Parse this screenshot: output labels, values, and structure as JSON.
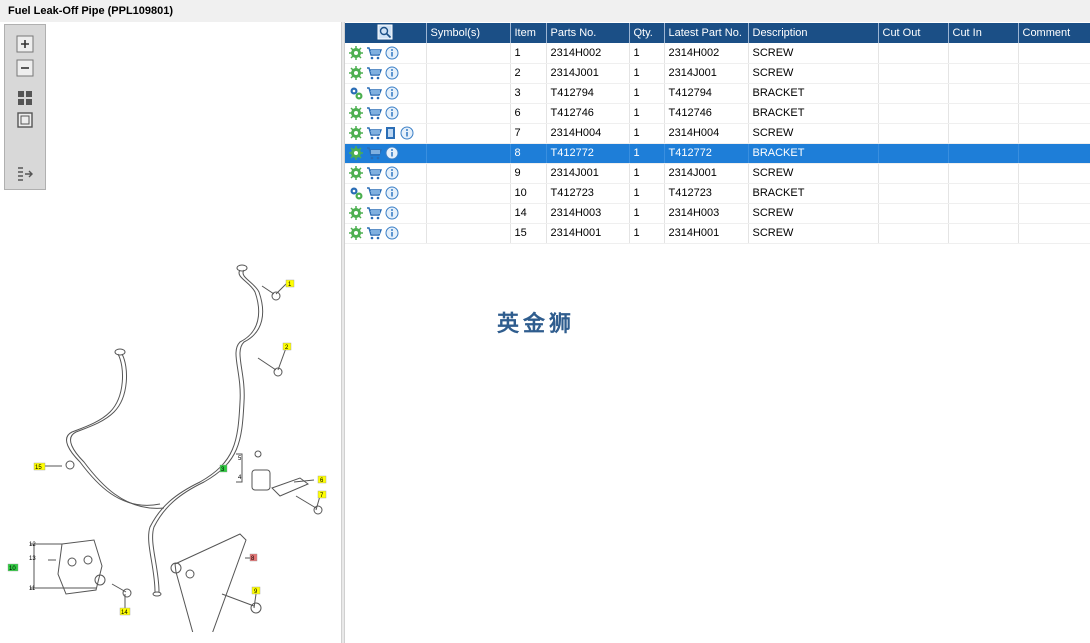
{
  "window": {
    "title": "Fuel Leak-Off Pipe (PPL109801)"
  },
  "zoom_toolbar": [
    {
      "name": "zoom-in-icon"
    },
    {
      "name": "zoom-out-icon"
    },
    {
      "name": "fit-all-icon"
    },
    {
      "name": "actual-size-icon"
    },
    {
      "name": "toggle-panel-icon"
    }
  ],
  "diagram": {
    "callouts": [
      "1",
      "2",
      "15",
      "5",
      "4",
      "6",
      "7",
      "12",
      "13",
      "11",
      "14",
      "8",
      "9"
    ],
    "box_labels": [
      "3",
      "10"
    ]
  },
  "table": {
    "columns": [
      "",
      "Symbol(s)",
      "Item",
      "Parts No.",
      "Qty.",
      "Latest Part No.",
      "Description",
      "Cut Out",
      "Cut In",
      "Comment"
    ],
    "rows": [
      {
        "item": "1",
        "parts_no": "2314H002",
        "qty": "1",
        "latest": "2314H002",
        "description": "SCREW",
        "cut_out": "",
        "cut_in": "",
        "comment": "",
        "icons": [
          "gear-icon",
          "cart-icon",
          "info-icon"
        ]
      },
      {
        "item": "2",
        "parts_no": "2314J001",
        "qty": "1",
        "latest": "2314J001",
        "description": "SCREW",
        "cut_out": "",
        "cut_in": "",
        "comment": "",
        "icons": [
          "gear-icon",
          "cart-icon",
          "info-icon"
        ]
      },
      {
        "item": "3",
        "parts_no": "T412794",
        "qty": "1",
        "latest": "T412794",
        "description": "BRACKET",
        "cut_out": "",
        "cut_in": "",
        "comment": "",
        "icons": [
          "gears-multi-icon",
          "cart-icon",
          "info-icon"
        ]
      },
      {
        "item": "6",
        "parts_no": "T412746",
        "qty": "1",
        "latest": "T412746",
        "description": "BRACKET",
        "cut_out": "",
        "cut_in": "",
        "comment": "",
        "icons": [
          "gear-icon",
          "cart-icon",
          "info-icon"
        ]
      },
      {
        "item": "7",
        "parts_no": "2314H004",
        "qty": "1",
        "latest": "2314H004",
        "description": "SCREW",
        "cut_out": "",
        "cut_in": "",
        "comment": "",
        "icons": [
          "gear-icon",
          "cart-icon",
          "document-icon",
          "info-icon"
        ]
      },
      {
        "item": "8",
        "parts_no": "T412772",
        "qty": "1",
        "latest": "T412772",
        "description": "BRACKET",
        "cut_out": "",
        "cut_in": "",
        "comment": "",
        "icons": [
          "gear-icon",
          "cart-icon",
          "info-icon"
        ],
        "selected": true
      },
      {
        "item": "9",
        "parts_no": "2314J001",
        "qty": "1",
        "latest": "2314J001",
        "description": "SCREW",
        "cut_out": "",
        "cut_in": "",
        "comment": "",
        "icons": [
          "gear-icon",
          "cart-icon",
          "info-icon"
        ]
      },
      {
        "item": "10",
        "parts_no": "T412723",
        "qty": "1",
        "latest": "T412723",
        "description": "BRACKET",
        "cut_out": "",
        "cut_in": "",
        "comment": "",
        "icons": [
          "gears-multi-icon",
          "cart-icon",
          "info-icon"
        ]
      },
      {
        "item": "14",
        "parts_no": "2314H003",
        "qty": "1",
        "latest": "2314H003",
        "description": "SCREW",
        "cut_out": "",
        "cut_in": "",
        "comment": "",
        "icons": [
          "gear-icon",
          "cart-icon",
          "info-icon"
        ]
      },
      {
        "item": "15",
        "parts_no": "2314H001",
        "qty": "1",
        "latest": "2314H001",
        "description": "SCREW",
        "cut_out": "",
        "cut_in": "",
        "comment": "",
        "icons": [
          "gear-icon",
          "cart-icon",
          "info-icon"
        ]
      }
    ]
  },
  "watermark": "英金狮",
  "colors": {
    "header_bg": "#1b4f86",
    "selected_row": "#1e7ed8",
    "callout_yellow": "#ffff00",
    "callout_green": "#2ecc40",
    "callout_red": "#e57373",
    "gear_green": "#4caf50",
    "cart_blue": "#2a6db5",
    "info_blue": "#3a7fc6"
  }
}
